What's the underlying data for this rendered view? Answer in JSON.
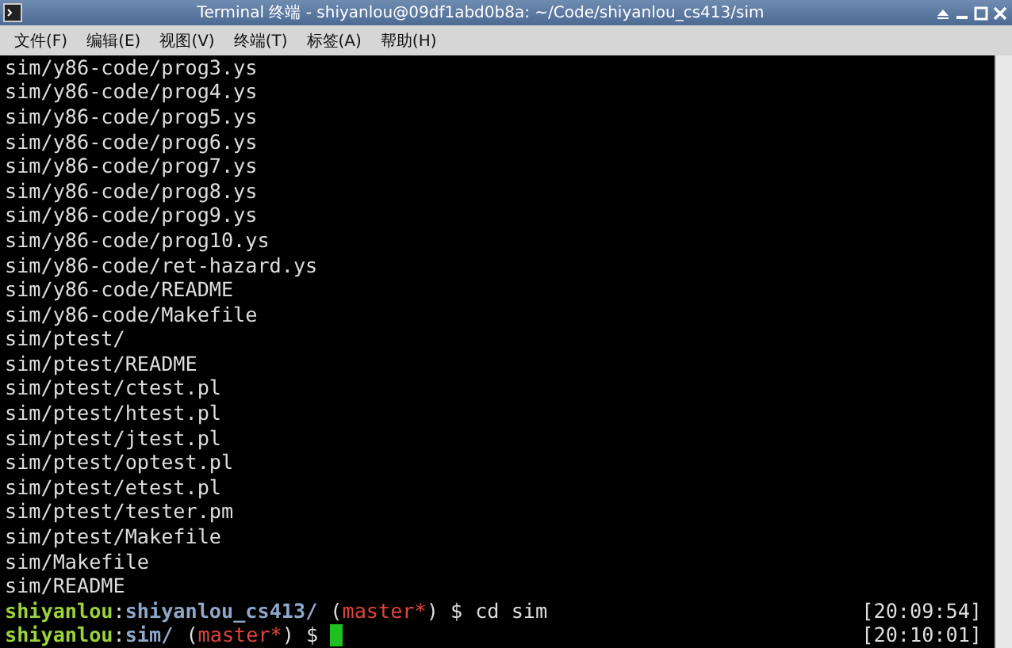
{
  "window": {
    "title": "Terminal 终端 - shiyanlou@09df1abd0b8a: ~/Code/shiyanlou_cs413/sim"
  },
  "menu": [
    "文件(F)",
    "编辑(E)",
    "视图(V)",
    "终端(T)",
    "标签(A)",
    "帮助(H)"
  ],
  "output": [
    "sim/y86-code/prog3.ys",
    "sim/y86-code/prog4.ys",
    "sim/y86-code/prog5.ys",
    "sim/y86-code/prog6.ys",
    "sim/y86-code/prog7.ys",
    "sim/y86-code/prog8.ys",
    "sim/y86-code/prog9.ys",
    "sim/y86-code/prog10.ys",
    "sim/y86-code/ret-hazard.ys",
    "sim/y86-code/README",
    "sim/y86-code/Makefile",
    "sim/ptest/",
    "sim/ptest/README",
    "sim/ptest/ctest.pl",
    "sim/ptest/htest.pl",
    "sim/ptest/jtest.pl",
    "sim/ptest/optest.pl",
    "sim/ptest/etest.pl",
    "sim/ptest/tester.pm",
    "sim/ptest/Makefile",
    "sim/Makefile",
    "sim/README"
  ],
  "prompts": [
    {
      "segments": [
        {
          "kind": "user",
          "text": "shiyanlou"
        },
        {
          "kind": "plain",
          "text": ":"
        },
        {
          "kind": "path",
          "text": "shiyanlou_cs413/"
        },
        {
          "kind": "plain",
          "text": "("
        },
        {
          "kind": "branch",
          "text": "master*"
        },
        {
          "kind": "plain",
          "text": ") $"
        },
        {
          "kind": "command",
          "text": "cd sim"
        }
      ],
      "time": "[20:09:54]",
      "cursor": false
    },
    {
      "segments": [
        {
          "kind": "user",
          "text": "shiyanlou"
        },
        {
          "kind": "plain",
          "text": ":"
        },
        {
          "kind": "path",
          "text": "sim/"
        },
        {
          "kind": "plain",
          "text": "("
        },
        {
          "kind": "branch",
          "text": "master*"
        },
        {
          "kind": "plain",
          "text": ") $"
        }
      ],
      "time": "[20:10:01]",
      "cursor": true
    }
  ]
}
